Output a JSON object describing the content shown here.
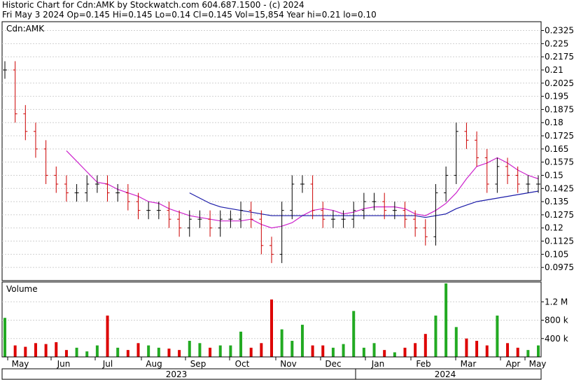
{
  "header": {
    "line1": "Historic Chart for Cdn:AMK by Stockwatch.com 604.687.1500 - (c) 2024",
    "line2": "Fri May  3 2024   Op=0.145  Hi=0.145  Lo=0.14  Cl=0.145  Vol=15,854  Year hi=0.21  lo=0.10"
  },
  "chart_data": [
    {
      "type": "ohlc",
      "title": "Cdn:AMK",
      "ylim": [
        0.09,
        0.2375
      ],
      "yticks": [
        "0.2325",
        "0.225",
        "0.2175",
        "0.21",
        "0.2025",
        "0.195",
        "0.1875",
        "0.18",
        "0.1725",
        "0.165",
        "0.1575",
        "0.15",
        "0.1425",
        "0.135",
        "0.1275",
        "0.12",
        "0.1125",
        "0.105",
        "0.0975"
      ],
      "x": [
        "2023-05-03",
        "2023-05-10",
        "2023-05-17",
        "2023-05-24",
        "2023-05-31",
        "2023-06-07",
        "2023-06-14",
        "2023-06-21",
        "2023-06-28",
        "2023-07-05",
        "2023-07-12",
        "2023-07-19",
        "2023-07-26",
        "2023-08-02",
        "2023-08-09",
        "2023-08-16",
        "2023-08-23",
        "2023-08-30",
        "2023-09-06",
        "2023-09-13",
        "2023-09-20",
        "2023-09-27",
        "2023-10-04",
        "2023-10-11",
        "2023-10-18",
        "2023-10-25",
        "2023-11-01",
        "2023-11-08",
        "2023-11-15",
        "2023-11-22",
        "2023-11-29",
        "2023-12-06",
        "2023-12-13",
        "2023-12-20",
        "2023-12-27",
        "2024-01-03",
        "2024-01-10",
        "2024-01-17",
        "2024-01-24",
        "2024-01-31",
        "2024-02-07",
        "2024-02-14",
        "2024-02-21",
        "2024-02-28",
        "2024-03-06",
        "2024-03-13",
        "2024-03-20",
        "2024-03-27",
        "2024-04-03",
        "2024-04-10",
        "2024-04-17",
        "2024-04-24",
        "2024-05-01"
      ],
      "series": [
        {
          "name": "Close",
          "values": [
            0.21,
            0.185,
            0.175,
            0.165,
            0.15,
            0.145,
            0.14,
            0.14,
            0.145,
            0.145,
            0.14,
            0.14,
            0.135,
            0.13,
            0.13,
            0.13,
            0.125,
            0.12,
            0.125,
            0.125,
            0.12,
            0.125,
            0.125,
            0.13,
            0.125,
            0.11,
            0.105,
            0.13,
            0.145,
            0.145,
            0.13,
            0.125,
            0.125,
            0.125,
            0.13,
            0.135,
            0.135,
            0.13,
            0.13,
            0.125,
            0.12,
            0.115,
            0.14,
            0.15,
            0.175,
            0.17,
            0.16,
            0.145,
            0.155,
            0.15,
            0.145,
            0.145,
            0.145
          ]
        },
        {
          "name": "MA short",
          "values": [
            null,
            null,
            null,
            null,
            null,
            null,
            0.164,
            0.158,
            0.152,
            0.146,
            0.145,
            0.142,
            0.14,
            0.138,
            0.135,
            0.134,
            0.131,
            0.129,
            0.127,
            0.126,
            0.125,
            0.124,
            0.124,
            0.124,
            0.125,
            0.122,
            0.12,
            0.121,
            0.123,
            0.127,
            0.13,
            0.131,
            0.13,
            0.128,
            0.129,
            0.131,
            0.132,
            0.132,
            0.132,
            0.131,
            0.128,
            0.127,
            0.13,
            0.134,
            0.14,
            0.148,
            0.155,
            0.157,
            0.16,
            0.157,
            0.153,
            0.15,
            0.148
          ]
        },
        {
          "name": "MA long",
          "values": [
            null,
            null,
            null,
            null,
            null,
            null,
            null,
            null,
            null,
            null,
            null,
            null,
            null,
            null,
            null,
            null,
            null,
            null,
            0.14,
            0.137,
            0.134,
            0.132,
            0.131,
            0.13,
            0.129,
            0.128,
            0.127,
            0.127,
            0.127,
            0.127,
            0.127,
            0.127,
            0.127,
            0.127,
            0.127,
            0.127,
            0.127,
            0.127,
            0.127,
            0.127,
            0.127,
            0.126,
            0.127,
            0.128,
            0.131,
            0.133,
            0.135,
            0.136,
            0.137,
            0.138,
            0.139,
            0.14,
            0.141
          ]
        }
      ],
      "colors": {
        "up": "#000000",
        "down": "#cc0000",
        "ma_short": "#cc22cc",
        "ma_long": "#1a1aa8"
      }
    },
    {
      "type": "bar",
      "title": "Volume",
      "yticks": [
        "1.2 M",
        "800 k",
        "400 k"
      ],
      "ylim": [
        0,
        1600000
      ],
      "x": [
        "2023-05-03",
        "2023-05-10",
        "2023-05-17",
        "2023-05-24",
        "2023-05-31",
        "2023-06-07",
        "2023-06-14",
        "2023-06-21",
        "2023-06-28",
        "2023-07-05",
        "2023-07-12",
        "2023-07-19",
        "2023-07-26",
        "2023-08-02",
        "2023-08-09",
        "2023-08-16",
        "2023-08-23",
        "2023-08-30",
        "2023-09-06",
        "2023-09-13",
        "2023-09-20",
        "2023-09-27",
        "2023-10-04",
        "2023-10-11",
        "2023-10-18",
        "2023-10-25",
        "2023-11-01",
        "2023-11-08",
        "2023-11-15",
        "2023-11-22",
        "2023-11-29",
        "2023-12-06",
        "2023-12-13",
        "2023-12-20",
        "2023-12-27",
        "2024-01-03",
        "2024-01-10",
        "2024-01-17",
        "2024-01-24",
        "2024-01-31",
        "2024-02-07",
        "2024-02-14",
        "2024-02-21",
        "2024-02-28",
        "2024-03-06",
        "2024-03-13",
        "2024-03-20",
        "2024-03-27",
        "2024-04-03",
        "2024-04-10",
        "2024-04-17",
        "2024-04-24",
        "2024-05-01"
      ],
      "values": [
        850000,
        250000,
        220000,
        300000,
        280000,
        320000,
        150000,
        200000,
        120000,
        250000,
        900000,
        200000,
        150000,
        300000,
        250000,
        200000,
        180000,
        150000,
        350000,
        300000,
        200000,
        250000,
        250000,
        550000,
        200000,
        300000,
        1250000,
        600000,
        350000,
        700000,
        250000,
        250000,
        200000,
        280000,
        1000000,
        200000,
        300000,
        150000,
        100000,
        200000,
        300000,
        500000,
        900000,
        1600000,
        650000,
        400000,
        350000,
        250000,
        900000,
        300000,
        200000,
        150000,
        250000
      ],
      "colors": {
        "up": "#22aa22",
        "down": "#dd0000"
      }
    }
  ],
  "xaxis": {
    "months": [
      "May",
      "Jun",
      "Jul",
      "Aug",
      "Sep",
      "Oct",
      "Nov",
      "Dec",
      "Jan",
      "Feb",
      "Mar",
      "Apr",
      "May"
    ],
    "years": [
      "2023",
      "2024"
    ]
  }
}
